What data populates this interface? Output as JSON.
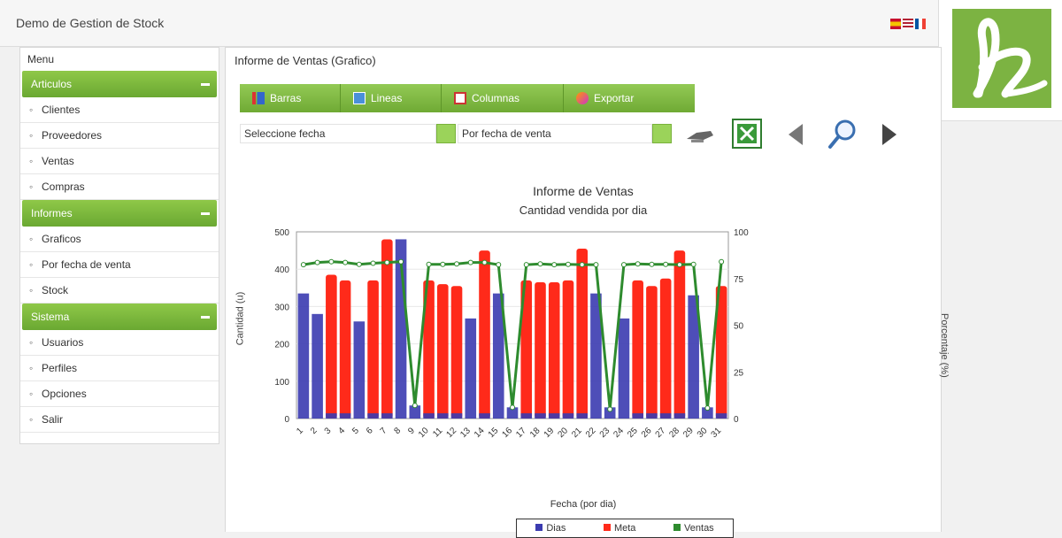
{
  "app": {
    "title": "Demo de Gestion de Stock"
  },
  "sidebar": {
    "heading": "Menu",
    "groups": [
      {
        "label": "Articulos",
        "items": [
          "Clientes",
          "Proveedores",
          "Ventas",
          "Compras"
        ]
      },
      {
        "label": "Informes",
        "items": [
          "Graficos",
          "Por fecha de venta",
          "Stock"
        ]
      },
      {
        "label": "Sistema",
        "items": [
          "Usuarios",
          "Perfiles",
          "Opciones",
          "Salir"
        ]
      }
    ]
  },
  "main": {
    "title": "Informe de Ventas (Grafico)",
    "toolbar": [
      {
        "label": "Barras",
        "icon": "bar-chart-icon"
      },
      {
        "label": "Lineas",
        "icon": "line-chart-icon"
      },
      {
        "label": "Columnas",
        "icon": "column-chart-icon"
      },
      {
        "label": "Exportar",
        "icon": "export-icon"
      }
    ],
    "filters": {
      "first": "Seleccione fecha",
      "second": "Por fecha de venta"
    },
    "controls": [
      "print-icon",
      "excel-icon",
      "prev-icon",
      "zoom-icon",
      "next-icon"
    ]
  },
  "chart_data": {
    "type": "bar",
    "title": "Informe de Ventas",
    "subtitle": "Cantidad vendida por dia",
    "xlabel": "Fecha (por dia)",
    "ylabel_left": "Cantidad (u)",
    "ylabel_right": "Porcentaje (%)",
    "ylim": [
      0,
      500
    ],
    "yticks": [
      0,
      100,
      200,
      300,
      400,
      500
    ],
    "yticks_right": [
      "0",
      "25",
      "50",
      "75",
      "100"
    ],
    "categories": [
      "1",
      "2",
      "3",
      "4",
      "5",
      "6",
      "7",
      "8",
      "9",
      "10",
      "11",
      "12",
      "13",
      "14",
      "15",
      "16",
      "17",
      "18",
      "19",
      "20",
      "21",
      "22",
      "23",
      "24",
      "25",
      "26",
      "27",
      "28",
      "29",
      "30",
      "31"
    ],
    "series": [
      {
        "name": "Dias",
        "color": "#3b3bb0",
        "values": [
          335,
          280,
          14,
          14,
          260,
          14,
          14,
          480,
          35,
          14,
          14,
          14,
          268,
          14,
          335,
          30,
          14,
          14,
          14,
          14,
          14,
          335,
          30,
          268,
          14,
          14,
          14,
          14,
          330,
          30,
          14
        ]
      },
      {
        "name": "Meta",
        "color": "#ff2a1a",
        "values": [
          0,
          0,
          385,
          370,
          0,
          370,
          480,
          0,
          0,
          370,
          360,
          355,
          0,
          450,
          0,
          0,
          370,
          365,
          365,
          370,
          455,
          0,
          0,
          0,
          370,
          355,
          375,
          450,
          0,
          0,
          355
        ]
      },
      {
        "name": "Ventas",
        "color": "#2e8b2e",
        "values": [
          412,
          418,
          420,
          418,
          413,
          416,
          418,
          420,
          35,
          413,
          413,
          414,
          418,
          418,
          412,
          30,
          412,
          414,
          412,
          413,
          412,
          412,
          25,
          412,
          414,
          413,
          413,
          412,
          413,
          28,
          420
        ]
      }
    ]
  }
}
